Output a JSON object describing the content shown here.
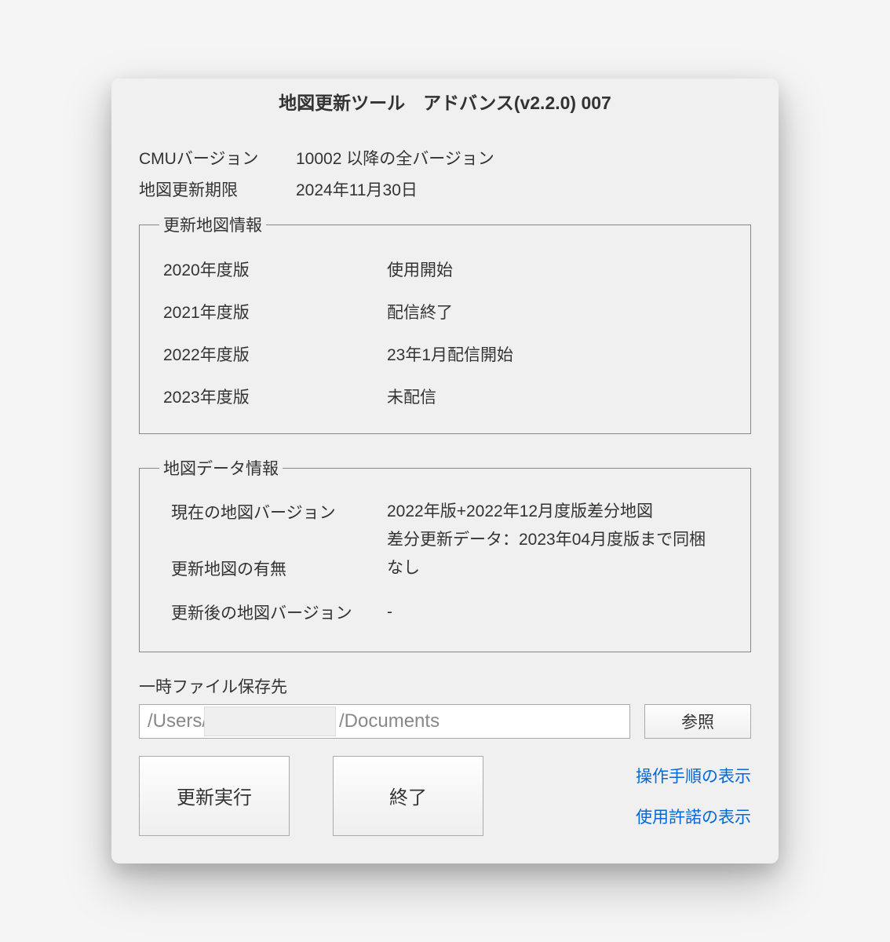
{
  "window": {
    "title": "地図更新ツール　アドバンス(v2.2.0) 007"
  },
  "info": {
    "cmu_label": "CMUバージョン",
    "cmu_value": "10002 以降の全バージョン",
    "expire_label": "地図更新期限",
    "expire_value": "2024年11月30日"
  },
  "map_info": {
    "legend": "更新地図情報",
    "rows": [
      {
        "year": "2020年度版",
        "status": "使用開始"
      },
      {
        "year": "2021年度版",
        "status": "配信終了"
      },
      {
        "year": "2022年度版",
        "status": "23年1月配信開始"
      },
      {
        "year": "2023年度版",
        "status": "未配信"
      }
    ]
  },
  "data_info": {
    "legend": "地図データ情報",
    "current_label": "現在の地図バージョン",
    "current_value": "2022年版+2022年12月度版差分地図",
    "diff_value": "差分更新データ：2023年04月度版まで同梱",
    "update_label": "更新地図の有無",
    "update_value": "なし",
    "after_label": "更新後の地図バージョン",
    "after_value": "-"
  },
  "temp": {
    "label": "一時ファイル保存先",
    "path_prefix": "/Users/",
    "path_suffix": "/Documents",
    "browse": "参照"
  },
  "buttons": {
    "run": "更新実行",
    "exit": "終了"
  },
  "links": {
    "manual": "操作手順の表示",
    "license": "使用許諾の表示"
  }
}
